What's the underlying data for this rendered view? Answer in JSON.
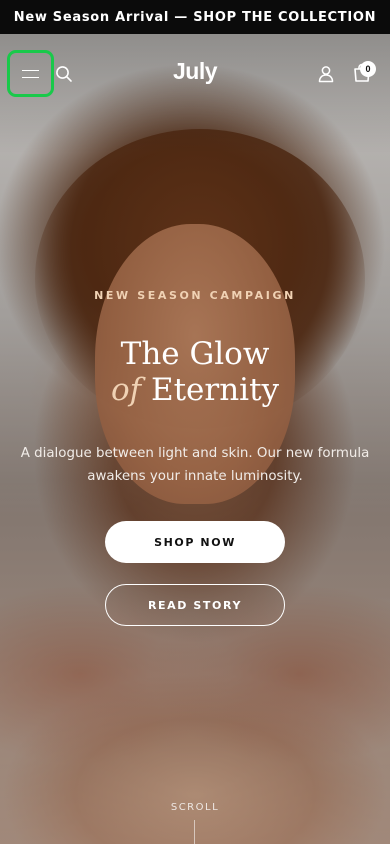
{
  "announcement": {
    "text": "New Season Arrival — SHOP THE COLLECTION"
  },
  "header": {
    "logo": "July",
    "cart_count": "0",
    "icons": {
      "menu": "hamburger-menu-icon",
      "search": "search-icon",
      "account": "account-icon",
      "cart": "shopping-bag-icon"
    },
    "menu_button_highlight_color": "#19c94a"
  },
  "hero": {
    "eyebrow": "NEW SEASON CAMPAIGN",
    "headline_line1": "The Glow",
    "headline_accent": "of",
    "headline_line2_rest": "Eternity",
    "subtext": "A dialogue between light and skin. Our new formula awakens your innate luminosity.",
    "primary_cta": "SHOP NOW",
    "secondary_cta": "READ STORY",
    "scroll_label": "SCROLL",
    "accent_color": "#f0d2b4"
  }
}
